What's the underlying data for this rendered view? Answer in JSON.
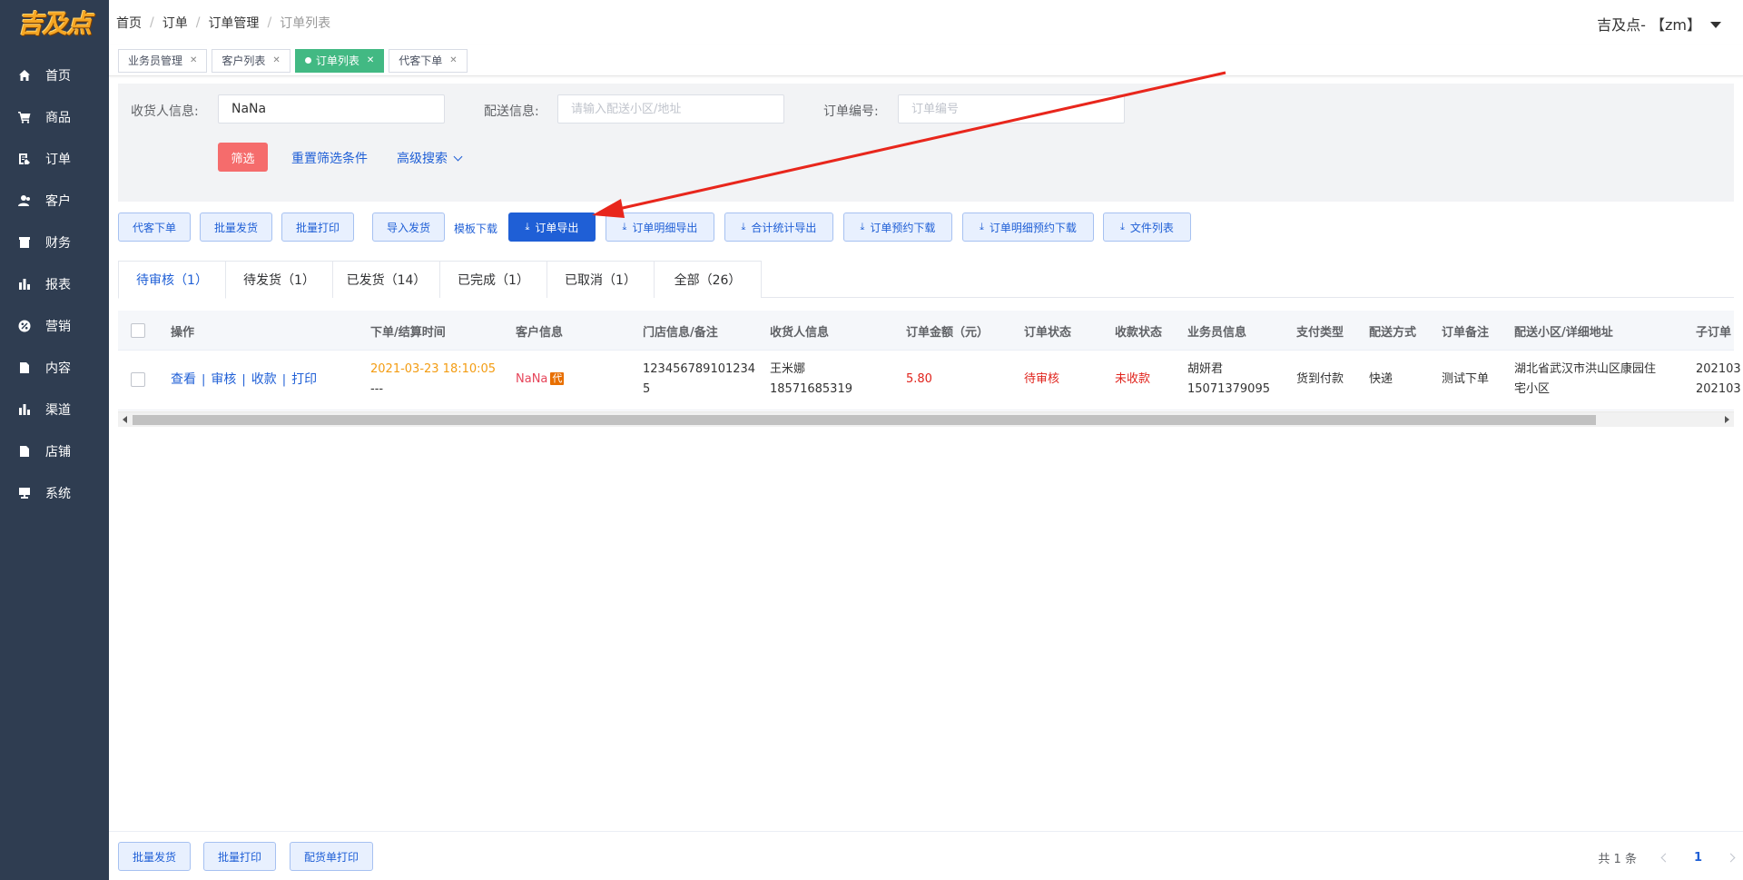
{
  "logo": {
    "text": "吉及点"
  },
  "sidebar": {
    "items": [
      {
        "label": "首页",
        "icon": "home-icon"
      },
      {
        "label": "商品",
        "icon": "cart-icon"
      },
      {
        "label": "订单",
        "icon": "order-icon"
      },
      {
        "label": "客户",
        "icon": "user-icon"
      },
      {
        "label": "财务",
        "icon": "finance-icon"
      },
      {
        "label": "报表",
        "icon": "bar-chart-icon"
      },
      {
        "label": "营销",
        "icon": "percent-icon"
      },
      {
        "label": "内容",
        "icon": "document-icon"
      },
      {
        "label": "渠道",
        "icon": "bar-chart-icon"
      },
      {
        "label": "店铺",
        "icon": "shop-icon"
      },
      {
        "label": "系统",
        "icon": "monitor-icon"
      }
    ]
  },
  "header": {
    "breadcrumb": [
      "首页",
      "订单",
      "订单管理",
      "订单列表"
    ],
    "separator": "/",
    "user": "吉及点- 【zm】"
  },
  "tags": [
    {
      "label": "业务员管理",
      "active": false
    },
    {
      "label": "客户列表",
      "active": false
    },
    {
      "label": "订单列表",
      "active": true
    },
    {
      "label": "代客下单",
      "active": false
    }
  ],
  "filter": {
    "receiver_label": "收货人信息:",
    "receiver_value": "NaNa",
    "delivery_label": "配送信息:",
    "delivery_placeholder": "请输入配送小区/地址",
    "order_no_label": "订单编号:",
    "order_no_placeholder": "订单编号",
    "filter_btn": "筛选",
    "reset_btn": "重置筛选条件",
    "advanced_btn": "高级搜索"
  },
  "actions": {
    "proxy_order": "代客下单",
    "batch_ship": "批量发货",
    "batch_print": "批量打印",
    "import_ship": "导入发货",
    "template_download": "模板下载",
    "order_export": "订单导出",
    "order_detail_export": "订单明细导出",
    "total_stats_export": "合计统计导出",
    "order_reserve_download": "订单预约下载",
    "order_detail_reserve_download": "订单明细预约下载",
    "file_list": "文件列表"
  },
  "status_tabs": [
    {
      "label": "待审核（1）",
      "active": true
    },
    {
      "label": "待发货（1）",
      "active": false
    },
    {
      "label": "已发货（14）",
      "active": false
    },
    {
      "label": "已完成（1）",
      "active": false
    },
    {
      "label": "已取消（1）",
      "active": false
    },
    {
      "label": "全部（26）",
      "active": false
    }
  ],
  "table": {
    "columns": [
      "操作",
      "下单/结算时间",
      "客户信息",
      "门店信息/备注",
      "收货人信息",
      "订单金额（元）",
      "订单状态",
      "收款状态",
      "业务员信息",
      "支付类型",
      "配送方式",
      "订单备注",
      "配送小区/详细地址",
      "子订单"
    ],
    "rows": [
      {
        "ops": [
          "查看",
          "审核",
          "收款",
          "打印"
        ],
        "time": "2021-03-23 18:10:05",
        "settle_time": "---",
        "customer": "NaNa",
        "customer_badge": "代",
        "store_line1": "123456789101234",
        "store_line2": "5",
        "receiver_name": "王米娜",
        "receiver_phone": "18571685319",
        "amount": "5.80",
        "order_status": "待审核",
        "pay_status": "未收款",
        "salesman_name": "胡妍君",
        "salesman_phone": "15071379095",
        "pay_type": "货到付款",
        "delivery": "快递",
        "remark": "测试下单",
        "address_line1": "湖北省武汉市洪山区康园住",
        "address_line2": "宅小区",
        "sub_line1": "202103",
        "sub_line2": "202103"
      }
    ]
  },
  "footer": {
    "batch_ship": "批量发货",
    "batch_print": "批量打印",
    "pick_print": "配货单打印",
    "total": "共 1 条",
    "page": "1"
  },
  "colors": {
    "sidebar": "#2f3d51",
    "primary": "#1f5fd6",
    "active_tag": "#42b983",
    "danger": "#f56c6c",
    "annotation": "#e8261c"
  }
}
